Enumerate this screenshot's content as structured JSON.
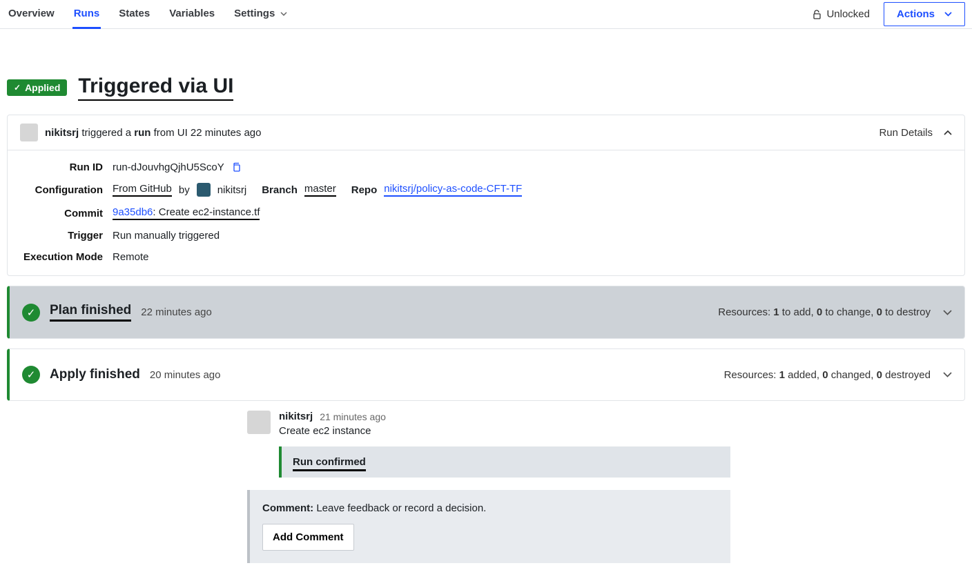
{
  "tabs": {
    "overview": "Overview",
    "runs": "Runs",
    "states": "States",
    "variables": "Variables",
    "settings": "Settings"
  },
  "topbar": {
    "lock_status": "Unlocked",
    "actions": "Actions"
  },
  "header": {
    "status_badge": "Applied",
    "title": "Triggered via UI"
  },
  "trigger": {
    "user": "nikitsrj",
    "verb": " triggered a ",
    "noun": "run",
    "source": " from UI 22 minutes ago",
    "run_details": "Run Details"
  },
  "details": {
    "run_id": {
      "label": "Run ID",
      "value": "run-dJouvhgQjhU5ScoY"
    },
    "configuration": {
      "label": "Configuration",
      "from": "From GitHub",
      "by": "by",
      "user": "nikitsrj",
      "branch_label": "Branch",
      "branch": "master",
      "repo_label": "Repo",
      "repo": "nikitsrj/policy-as-code-CFT-TF"
    },
    "commit": {
      "label": "Commit",
      "sha": "9a35db6",
      "message": ": Create ec2-instance.tf"
    },
    "trigger": {
      "label": "Trigger",
      "value": "Run manually triggered"
    },
    "execution_mode": {
      "label": "Execution Mode",
      "value": "Remote"
    }
  },
  "plan": {
    "title": "Plan finished",
    "time": "22 minutes ago",
    "resources_prefix": "Resources: ",
    "add": "1",
    "add_suffix": " to add, ",
    "change": "0",
    "change_suffix": " to change, ",
    "destroy": "0",
    "destroy_suffix": " to destroy"
  },
  "apply": {
    "title": "Apply finished",
    "time": "20 minutes ago",
    "resources_prefix": "Resources: ",
    "add": "1",
    "add_suffix": " added, ",
    "change": "0",
    "change_suffix": " changed, ",
    "destroy": "0",
    "destroy_suffix": " destroyed"
  },
  "comment": {
    "user": "nikitsrj",
    "time": "21 minutes ago",
    "text": "Create ec2 instance",
    "confirmed": "Run confirmed"
  },
  "comment_box": {
    "label": "Comment:",
    "placeholder": " Leave feedback or record a decision.",
    "button": "Add Comment"
  }
}
